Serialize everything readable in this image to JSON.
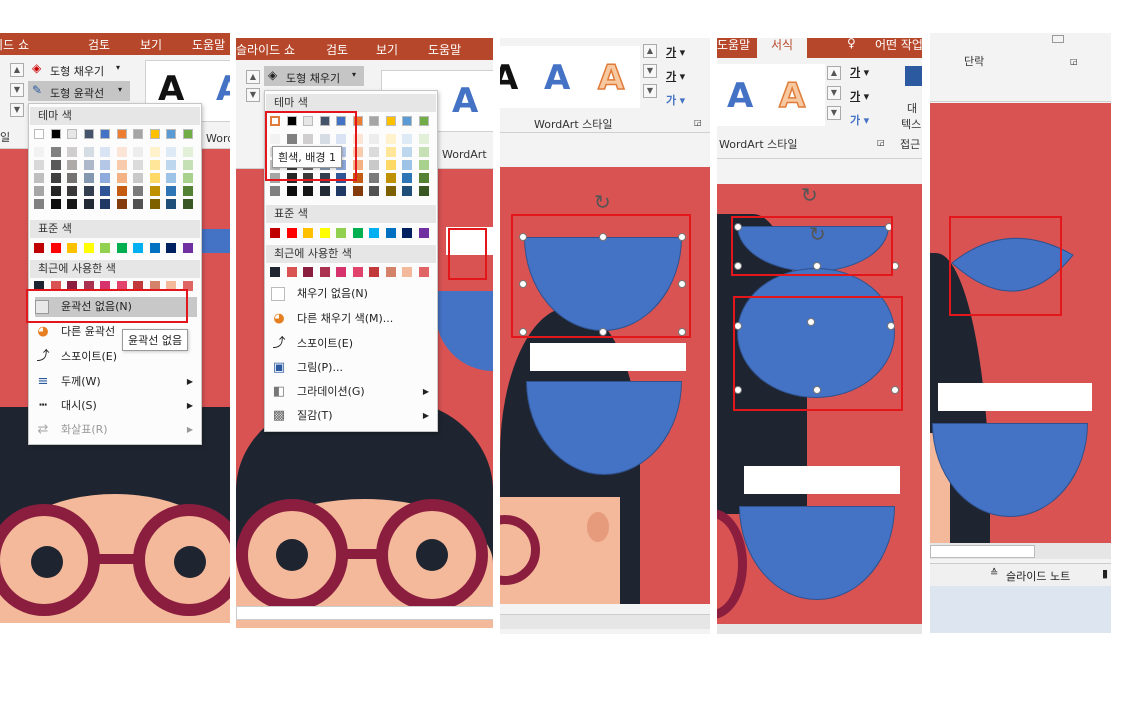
{
  "panel1": {
    "tabs": [
      "슬라이드 쇼",
      "검토",
      "보기",
      "도움말"
    ],
    "fill_label": "도형 채우기",
    "outline_label": "도형 윤곽선",
    "side_label": "일",
    "wordart_partial": "Word",
    "theme_colors_label": "테마 색",
    "standard_colors_label": "표준 색",
    "recent_colors_label": "최근에 사용한 색",
    "no_outline": "윤곽선 없음(N)",
    "more_outline": "다른 윤곽선",
    "eyedropper": "스포이트(E)",
    "weight": "두께(W)",
    "dash": "대시(S)",
    "arrows": "화살표(R)",
    "tooltip": "윤곽선 없음"
  },
  "panel2": {
    "tabs": [
      "슬라이드 쇼",
      "검토",
      "보기",
      "도움말"
    ],
    "fill_label": "도형 채우기",
    "wordart_partial": "WordArt",
    "theme_colors_label": "테마 색",
    "tooltip": "흰색, 배경 1",
    "standard_colors_label": "표준 색",
    "recent_colors_label": "최근에 사용한 색",
    "no_fill": "채우기 없음(N)",
    "more_fill": "다른 채우기 색(M)...",
    "eyedropper": "스포이트(E)",
    "picture": "그림(P)...",
    "gradient": "그라데이션(G)",
    "texture": "질감(T)"
  },
  "panel3": {
    "wordart_styles_label": "WordArt 스타일",
    "text_fill_icon": "가",
    "text_outline_icon": "가",
    "text_effect_icon": "가"
  },
  "panel4": {
    "tabs": [
      "도움말",
      "서식",
      "어떤 작업"
    ],
    "wordart_styles_label": "WordArt 스타일",
    "text_box_label": "텍스",
    "text_box_label2": "대",
    "side_label": "접근",
    "text_fill_icon": "가",
    "text_outline_icon": "가",
    "text_effect_icon": "가"
  },
  "panel5": {
    "paragraph_label": "단락",
    "notes_label": "슬라이드 노트"
  },
  "wordart_letter": "A",
  "colors": {
    "ribbon_red": "#b7472a",
    "slide_red": "#d95353",
    "shape_blue": "#4472c4",
    "hair_dark": "#1f2530",
    "skin": "#f4b89a",
    "glasses": "#8b1e3f",
    "highlight_red": "#e3161b"
  }
}
